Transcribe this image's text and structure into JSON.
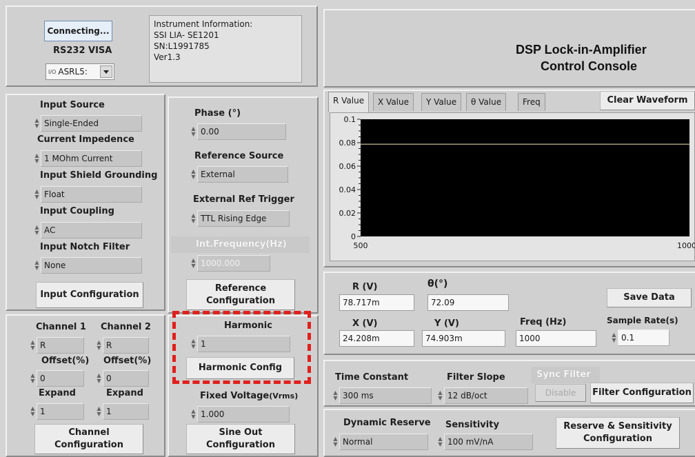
{
  "connection": {
    "button_label": "Connecting...",
    "visa_label": "RS232 VISA",
    "port_value": "ASRL5:",
    "port_prefix": "I/O"
  },
  "instrument_info": {
    "line1": "Instrument Information:",
    "line2": "SSI LIA- SE1201",
    "line3": "SN:L1991785",
    "line4": "Ver1.3"
  },
  "header": {
    "title_line1": "DSP Lock-in-Amplifier",
    "title_line2": "Control Console"
  },
  "input": {
    "source_label": "Input Source",
    "source_value": "Single-Ended",
    "impedance_label": "Current Impedence",
    "impedance_value": "1 MOhm Current",
    "grounding_label": "Input Shield Grounding",
    "grounding_value": "Float",
    "coupling_label": "Input Coupling",
    "coupling_value": "AC",
    "notch_label": "Input Notch Filter",
    "notch_value": "None",
    "config_button": "Input Configuration"
  },
  "reference": {
    "phase_label": "Phase (°)",
    "phase_value": "0.00",
    "source_label": "Reference Source",
    "source_value": "External",
    "trigger_label": "External Ref Trigger",
    "trigger_value": "TTL Rising Edge",
    "int_freq_label": "Int.Frequency(Hz)",
    "int_freq_value": "1000.000",
    "config_button_line1": "Reference",
    "config_button_line2": "Configuration"
  },
  "channel": {
    "ch1_label": "Channel 1",
    "ch2_label": "Channel  2",
    "ch1_value": "R",
    "ch2_value": "R",
    "offset1_label": "Offset(%)",
    "offset2_label": "Offset(%)",
    "offset1_value": "0",
    "offset2_value": "0",
    "expand1_label": "Expand",
    "expand2_label": "Expand",
    "expand1_value": "1",
    "expand2_value": "1",
    "config_button_line1": "Channel",
    "config_button_line2": "Configuration"
  },
  "harmonic": {
    "label": "Harmonic",
    "value": "1",
    "config_button": "Harmonic  Config"
  },
  "sine_out": {
    "voltage_label_main": "Fixed Voltage",
    "voltage_label_unit": "(Vrms)",
    "voltage_value": "1.000",
    "config_button_line1": "Sine Out",
    "config_button_line2": "Configuration"
  },
  "tabs": [
    {
      "label": "R Value"
    },
    {
      "label": "X Value"
    },
    {
      "label": "Y Value"
    },
    {
      "label": "θ Value"
    },
    {
      "label": "Freq"
    }
  ],
  "clear_button": "Clear Waveform",
  "chart_data": {
    "type": "line",
    "x": [
      500,
      1000
    ],
    "series": [
      {
        "values": [
          0.078717,
          0.078717
        ],
        "color": "#d9cfa0"
      }
    ],
    "xlim": [
      500,
      1000
    ],
    "ylim": [
      0,
      0.1
    ],
    "yticks": [
      "0.1",
      "0.08",
      "0.06",
      "0.04",
      "0.02",
      "0"
    ],
    "xticks": [
      "500",
      "1000"
    ],
    "background": "#000000"
  },
  "readouts": {
    "r_label": "R (V)",
    "r_value": "78.717m",
    "theta_label": "θ(°)",
    "theta_value": "72.09",
    "x_label": "X (V)",
    "x_value": "24.208m",
    "y_label": "Y (V)",
    "y_value": "74.903m",
    "freq_label": "Freq (Hz)",
    "freq_value": "1000",
    "save_button": "Save Data",
    "sample_rate_label": "Sample Rate(s)",
    "sample_rate_value": "0.1"
  },
  "filter": {
    "time_constant_label": "Time Constant",
    "time_constant_value": "300 ms",
    "slope_label": "Filter Slope",
    "slope_value": "12 dB/oct",
    "sync_label": "Sync Filter",
    "sync_button": "Disable",
    "config_button": "Filter Configuration"
  },
  "reserve": {
    "dynamic_label": "Dynamic Reserve",
    "dynamic_value": "Normal",
    "sensitivity_label": "Sensitivity",
    "sensitivity_value": "100 mV/nA",
    "config_button_line1": "Reserve & Sensitivity",
    "config_button_line2": "Configuration"
  },
  "colors": {
    "panel_bg": "#d0d0d0",
    "highlight_dash": "#e0201c",
    "plot_bg": "#000000",
    "trace": "#d9cfa0"
  }
}
